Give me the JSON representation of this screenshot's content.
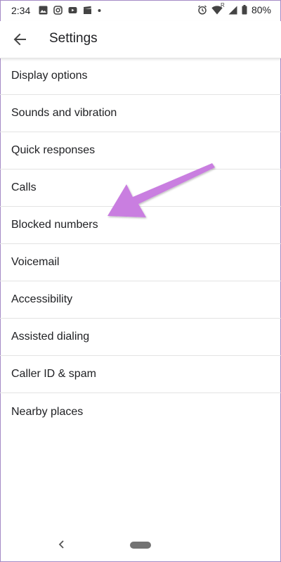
{
  "status_bar": {
    "time": "2:34",
    "notification_icons": [
      "image-icon",
      "instagram-icon",
      "youtube-icon",
      "clapper-icon",
      "dot-icon"
    ],
    "system_icons": [
      "alarm-icon",
      "wifi-icon",
      "signal-icon",
      "battery-icon"
    ],
    "roaming_label": "R",
    "battery_percent": "80%"
  },
  "app_bar": {
    "title": "Settings",
    "back_icon": "arrow-left-icon"
  },
  "settings": {
    "items": [
      {
        "label": "Display options"
      },
      {
        "label": "Sounds and vibration"
      },
      {
        "label": "Quick responses"
      },
      {
        "label": "Calls"
      },
      {
        "label": "Blocked numbers"
      },
      {
        "label": "Voicemail"
      },
      {
        "label": "Accessibility"
      },
      {
        "label": "Assisted dialing"
      },
      {
        "label": "Caller ID & spam"
      },
      {
        "label": "Nearby places"
      }
    ]
  },
  "annotation": {
    "icon": "pointer-arrow-icon",
    "color": "#c97ee0",
    "points_to": "Blocked numbers"
  },
  "navigation_bar": {
    "back_icon": "chevron-left-icon",
    "home_icon": "home-pill-icon"
  },
  "colors": {
    "text": "#202124",
    "divider": "#e3e3e3",
    "frame_border": "#a58bc5",
    "annotation_arrow": "#c97ee0"
  }
}
